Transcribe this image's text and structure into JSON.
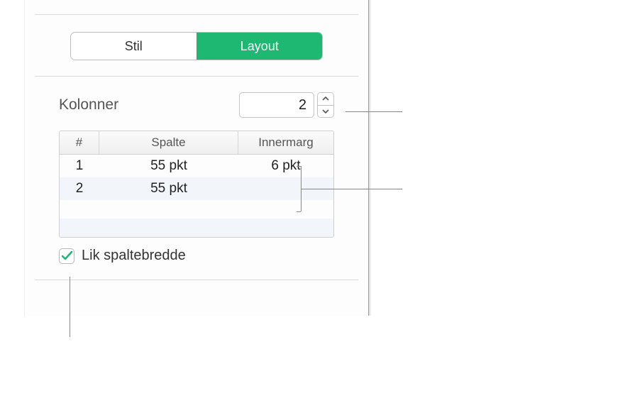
{
  "tabs": {
    "stil": "Stil",
    "layout": "Layout"
  },
  "columns": {
    "label": "Kolonner",
    "value": "2"
  },
  "table": {
    "headers": {
      "num": "#",
      "spalte": "Spalte",
      "inner": "Innermarg"
    },
    "rows": [
      {
        "num": "1",
        "spalte": "55 pkt",
        "inner": "6 pkt"
      },
      {
        "num": "2",
        "spalte": "55 pkt",
        "inner": ""
      }
    ]
  },
  "equalWidth": {
    "label": "Lik spaltebredde",
    "checked": true
  }
}
